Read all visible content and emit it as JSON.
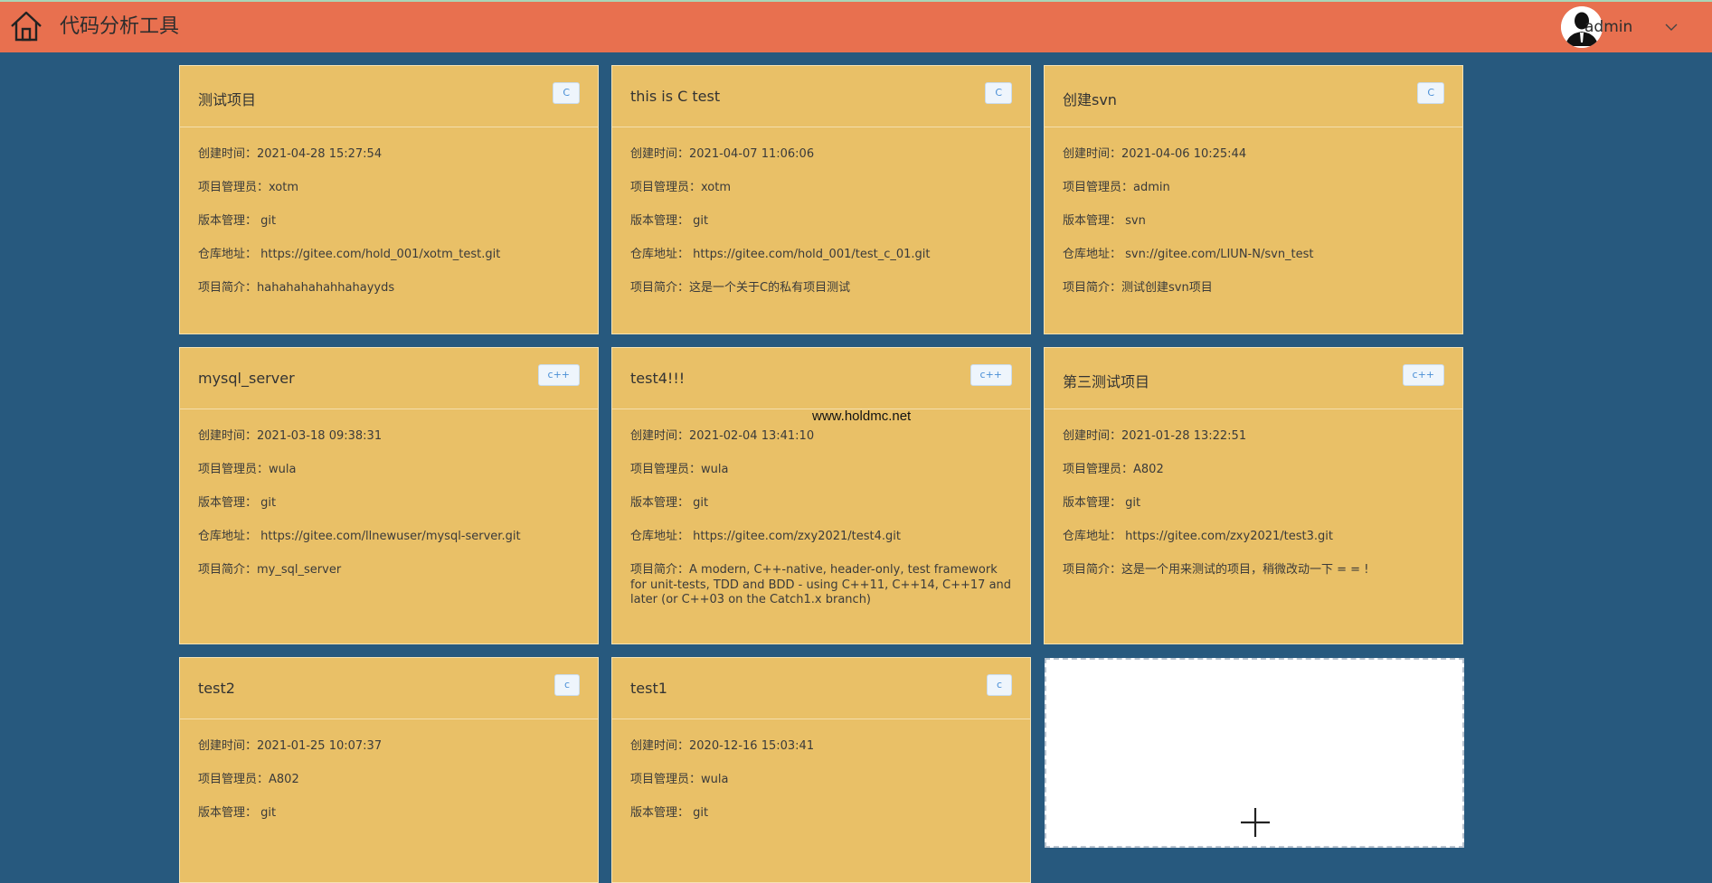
{
  "header": {
    "title": "代码分析工具",
    "user": "admin"
  },
  "colors": {
    "header_bg": "#e8704f",
    "page_bg": "#27597e",
    "card_bg": "#e9c067",
    "badge_text": "#4a8fd6"
  },
  "labels": {
    "created": "创建时间：",
    "manager": "项目管理员：",
    "vcs": "版本管理：",
    "repo": "仓库地址：",
    "desc": "项目简介："
  },
  "projects": [
    {
      "name": "测试项目",
      "lang": "C",
      "created": "2021-04-28 15:27:54",
      "manager": "xotm",
      "vcs": "git",
      "repo": "https://gitee.com/hold_001/xotm_test.git",
      "desc": "hahahahahahhahayyds"
    },
    {
      "name": "this is C test",
      "lang": "C",
      "created": "2021-04-07 11:06:06",
      "manager": "xotm",
      "vcs": "git",
      "repo": "https://gitee.com/hold_001/test_c_01.git",
      "desc": "这是一个关于C的私有项目测试"
    },
    {
      "name": "创建svn",
      "lang": "C",
      "created": "2021-04-06 10:25:44",
      "manager": "admin",
      "vcs": "svn",
      "repo": "svn://gitee.com/LIUN-N/svn_test",
      "desc": "测试创建svn项目"
    },
    {
      "name": "mysql_server",
      "lang": "c++",
      "created": "2021-03-18 09:38:31",
      "manager": "wula",
      "vcs": "git",
      "repo": "https://gitee.com/llnewuser/mysql-server.git",
      "desc": "my_sql_server"
    },
    {
      "name": "test4!!!",
      "lang": "c++",
      "created": "2021-02-04 13:41:10",
      "manager": "wula",
      "vcs": "git",
      "repo": "https://gitee.com/zxy2021/test4.git",
      "desc": "A modern, C++-native, header-only, test framework for unit-tests, TDD and BDD - using C++11, C++14, C++17 and later (or C++03 on the Catch1.x branch)"
    },
    {
      "name": "第三测试项目",
      "lang": "c++",
      "created": "2021-01-28 13:22:51",
      "manager": "A802",
      "vcs": "git",
      "repo": "https://gitee.com/zxy2021/test3.git",
      "desc": "这是一个用来测试的项目，稍微改动一下 = = !"
    },
    {
      "name": "test2",
      "lang": "c",
      "created": "2021-01-25 10:07:37",
      "manager": "A802",
      "vcs": "git",
      "repo": "",
      "desc": ""
    },
    {
      "name": "test1",
      "lang": "c",
      "created": "2020-12-16 15:03:41",
      "manager": "wula",
      "vcs": "git",
      "repo": "",
      "desc": ""
    }
  ],
  "watermark": "www.holdmc.net"
}
